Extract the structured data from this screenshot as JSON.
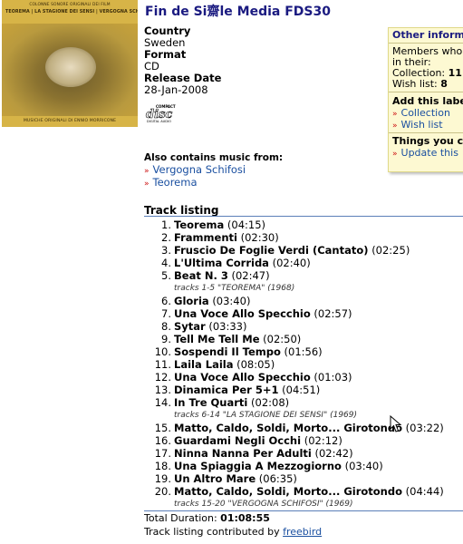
{
  "cover": {
    "line1": "COLONNE SONORE ORIGINALI DEI FILM",
    "line2": "TEOREMA | LA STAGIONE DEI SENSI | VERGOGNA SCHIFOSI",
    "line3": "MUSICHE ORIGINALI DI ENNIO MORRICONE"
  },
  "title": "Fin de Si齋le Media FDS30",
  "meta": {
    "country_label": "Country",
    "country": "Sweden",
    "format_label": "Format",
    "format": "CD",
    "release_label": "Release Date",
    "release": "28-Jan-2008"
  },
  "disc_logo": {
    "line1": "COMPACT",
    "line2": "disc",
    "line3": "DIGITAL AUDIO"
  },
  "also": {
    "title": "Also contains music from:",
    "links": [
      "Vergogna Schifosi",
      "Teorema"
    ]
  },
  "tracklist": {
    "heading": "Track listing",
    "tracks": [
      {
        "num": "1.",
        "title": "Teorema",
        "dur": "(04:15)"
      },
      {
        "num": "2.",
        "title": "Frammenti",
        "dur": "(02:30)"
      },
      {
        "num": "3.",
        "title": "Fruscio De Foglie Verdi (Cantato)",
        "dur": "(02:25)"
      },
      {
        "num": "4.",
        "title": "L'Ultima Corrida",
        "dur": "(02:40)"
      },
      {
        "num": "5.",
        "title": "Beat N. 3",
        "dur": "(02:47)"
      },
      {
        "num": "6.",
        "title": "Gloria",
        "dur": "(03:40)"
      },
      {
        "num": "7.",
        "title": "Una Voce Allo Specchio",
        "dur": "(02:57)"
      },
      {
        "num": "8.",
        "title": "Sytar",
        "dur": "(03:33)"
      },
      {
        "num": "9.",
        "title": "Tell Me Tell Me",
        "dur": "(02:50)"
      },
      {
        "num": "10.",
        "title": "Sospendi Il Tempo",
        "dur": "(01:56)"
      },
      {
        "num": "11.",
        "title": "Laila Laila",
        "dur": "(08:05)"
      },
      {
        "num": "12.",
        "title": "Una Voce Allo Specchio",
        "dur": "(01:03)"
      },
      {
        "num": "13.",
        "title": "Dinamica Per 5+1",
        "dur": "(04:51)"
      },
      {
        "num": "14.",
        "title": "In Tre Quarti",
        "dur": "(02:08)"
      },
      {
        "num": "15.",
        "title": "Matto, Caldo, Soldi, Morto... Girotondo",
        "dur": "(03:22)"
      },
      {
        "num": "16.",
        "title": "Guardami Negli Occhi",
        "dur": "(02:12)"
      },
      {
        "num": "17.",
        "title": "Ninna Nanna Per Adulti",
        "dur": "(02:42)"
      },
      {
        "num": "18.",
        "title": "Una Spiaggia A Mezzogiorno",
        "dur": "(03:40)"
      },
      {
        "num": "19.",
        "title": "Un Altro Mare",
        "dur": "(06:35)"
      },
      {
        "num": "20.",
        "title": "Matto, Caldo, Soldi, Morto... Girotondo",
        "dur": "(04:44)"
      }
    ],
    "notes": {
      "n1": "tracks 1-5 \"TEOREMA\" (1968)",
      "n2": "tracks 6-14 \"LA STAGIONE DEI SENSI\" (1969)",
      "n3": "tracks 15-20 \"VERGOGNA SCHIFOSI\" (1969)"
    },
    "total_label": "Total Duration:",
    "total": "01:08:55",
    "contrib_text": "Track listing contributed by",
    "contrib_user": "freebird"
  },
  "sidebar": {
    "other_heading": "Other inform",
    "members_line1": "Members who",
    "members_line2": "in their:",
    "collection_label": "Collection:",
    "collection_count": "11",
    "wishlist_label": "Wish list:",
    "wishlist_count": "8",
    "add_heading": "Add this labe",
    "add_collection": "Collection",
    "add_wishlist": "Wish list",
    "things_heading": "Things you c",
    "update_link": "Update this"
  }
}
